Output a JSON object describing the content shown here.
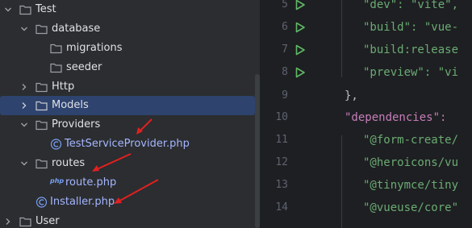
{
  "tree": {
    "items": [
      {
        "id": "test",
        "label": "Test",
        "kind": "folder",
        "expanded": true
      },
      {
        "id": "database",
        "label": "database",
        "kind": "folder",
        "expanded": true
      },
      {
        "id": "migrations",
        "label": "migrations",
        "kind": "folder"
      },
      {
        "id": "seeder",
        "label": "seeder",
        "kind": "folder"
      },
      {
        "id": "http",
        "label": "Http",
        "kind": "folder",
        "expanded": false
      },
      {
        "id": "models",
        "label": "Models",
        "kind": "folder",
        "expanded": false,
        "selected": true
      },
      {
        "id": "providers",
        "label": "Providers",
        "kind": "folder",
        "expanded": true
      },
      {
        "id": "testserviceprovider",
        "label": "TestServiceProvider.php",
        "kind": "php-class"
      },
      {
        "id": "routes",
        "label": "routes",
        "kind": "folder",
        "expanded": true
      },
      {
        "id": "route",
        "label": "route.php",
        "kind": "php-file",
        "badge": "php"
      },
      {
        "id": "installer",
        "label": "Installer.php",
        "kind": "php-class"
      },
      {
        "id": "user",
        "label": "User",
        "kind": "folder",
        "expanded": false
      }
    ]
  },
  "editor": {
    "lines": [
      {
        "num": "5",
        "run": true,
        "text": "\"dev\": \"vite\","
      },
      {
        "num": "6",
        "run": true,
        "text": "\"build\": \"vue-"
      },
      {
        "num": "7",
        "run": true,
        "text": "\"build:release"
      },
      {
        "num": "8",
        "run": true,
        "text": "\"preview\": \"vi"
      },
      {
        "num": "9",
        "run": false,
        "text": "},"
      },
      {
        "num": "10",
        "run": false,
        "text": "\"dependencies\": "
      },
      {
        "num": "11",
        "run": false,
        "text": "\"@form-create/"
      },
      {
        "num": "12",
        "run": false,
        "text": "\"@heroicons/vu"
      },
      {
        "num": "13",
        "run": false,
        "text": "\"@tinymce/tiny"
      },
      {
        "num": "14",
        "run": false,
        "text": "\"@vueuse/core\""
      }
    ]
  },
  "colors": {
    "panel_bg": "#2b2d30",
    "editor_bg": "#1e1f22",
    "selection": "#2e436e",
    "folder_icon": "#9da0a8",
    "php_class_icon": "#7aa2f7",
    "run_icon": "#5fb865",
    "string": "#6aab73",
    "arrow": "#e02020"
  }
}
